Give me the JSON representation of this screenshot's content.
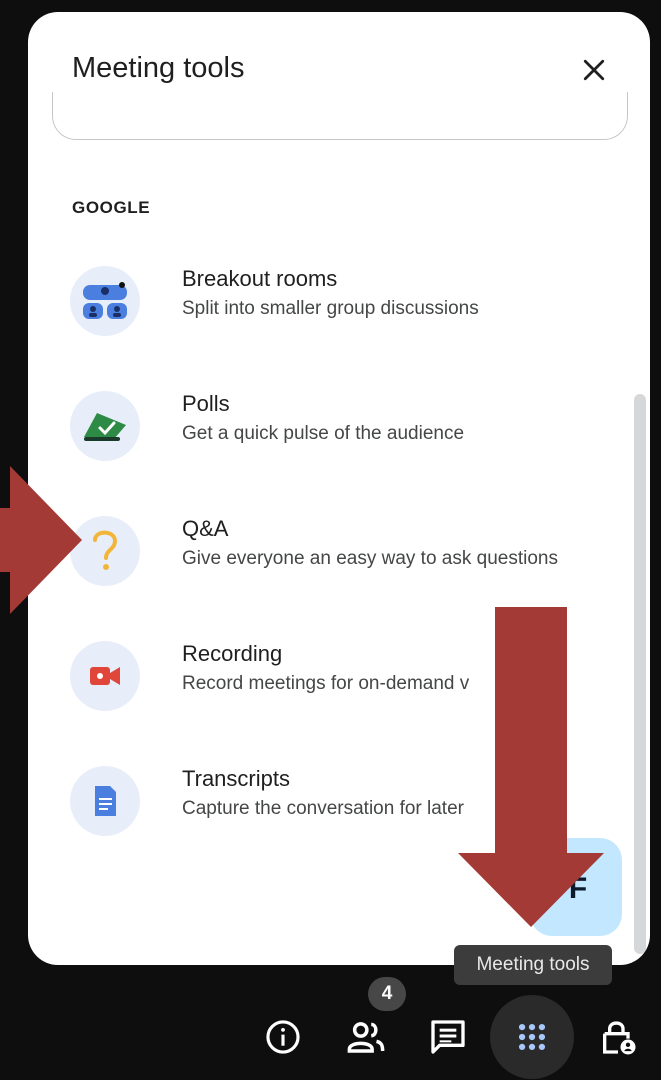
{
  "panel": {
    "title": "Meeting tools",
    "section_label": "GOOGLE",
    "tools": [
      {
        "name": "Breakout rooms",
        "description": "Split into smaller group discussions",
        "icon": "breakout-rooms-icon"
      },
      {
        "name": "Polls",
        "description": "Get a quick pulse of the audience",
        "icon": "polls-icon"
      },
      {
        "name": "Q&A",
        "description": "Give everyone an easy way to ask questions",
        "icon": "qa-icon"
      },
      {
        "name": "Recording",
        "description": "Record meetings for on-demand v",
        "icon": "recording-icon"
      },
      {
        "name": "Transcripts",
        "description": "Capture the conversation for later",
        "icon": "transcripts-icon"
      }
    ],
    "fab_letter": "F"
  },
  "tooltip": "Meeting tools",
  "bottom_bar": {
    "people_count": "4",
    "buttons": [
      "info-icon",
      "people-icon",
      "chat-icon",
      "meeting-tools-icon",
      "host-controls-icon"
    ]
  },
  "colors": {
    "annotation_arrow": "#a33a36",
    "fab_background": "#c2e7ff",
    "icon_background": "#e8eef9"
  }
}
